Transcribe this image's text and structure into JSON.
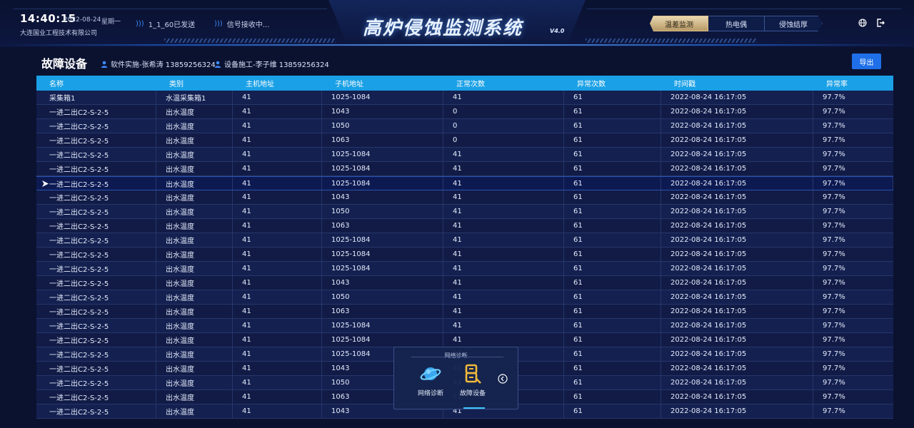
{
  "header": {
    "time": "14:40:15",
    "date": "2022-08-24",
    "weekday": "星期一",
    "company": "大连国业工程技术有限公司",
    "status_sent": "1_1_60已发送",
    "status_receiving": "信号接收中...",
    "title": "高炉侵蚀监测系统",
    "version": "V4.0",
    "tabs": [
      {
        "label": "温差监测",
        "active": true
      },
      {
        "label": "热电偶",
        "active": false
      },
      {
        "label": "侵蚀结厚",
        "active": false
      }
    ],
    "icons": {
      "language": "globe-icon",
      "logout": "exit-icon"
    }
  },
  "page": {
    "title": "故障设备",
    "contact_software": "软件实施-张希涛 13859256324",
    "contact_device": "设备施工-李子维 13859256324",
    "export_label": "导出"
  },
  "table": {
    "columns": [
      "名称",
      "类别",
      "主机地址",
      "子机地址",
      "正常次数",
      "异常次数",
      "时间戳",
      "异常率"
    ],
    "rows": [
      [
        "采集箱1",
        "水温采集箱1",
        "41",
        "1025-1084",
        "41",
        "61",
        "2022-08-24  16:17:05",
        "97.7%"
      ],
      [
        "一进二出C2-S-2-5",
        "出水温度",
        "41",
        "1043",
        "0",
        "61",
        "2022-08-24  16:17:05",
        "97.7%"
      ],
      [
        "一进二出C2-S-2-5",
        "出水温度",
        "41",
        "1050",
        "0",
        "61",
        "2022-08-24  16:17:05",
        "97.7%"
      ],
      [
        "一进二出C2-S-2-5",
        "出水温度",
        "41",
        "1063",
        "0",
        "61",
        "2022-08-24  16:17:05",
        "97.7%"
      ],
      [
        "一进二出C2-S-2-5",
        "出水温度",
        "41",
        "1025-1084",
        "41",
        "61",
        "2022-08-24  16:17:05",
        "97.7%"
      ],
      [
        "一进二出C2-S-2-5",
        "出水温度",
        "41",
        "1025-1084",
        "41",
        "61",
        "2022-08-24  16:17:05",
        "97.7%"
      ],
      [
        "一进二出C2-S-2-5",
        "出水温度",
        "41",
        "1025-1084",
        "41",
        "61",
        "2022-08-24  16:17:05",
        "97.7%"
      ],
      [
        "一进二出C2-S-2-5",
        "出水温度",
        "41",
        "1043",
        "41",
        "61",
        "2022-08-24  16:17:05",
        "97.7%"
      ],
      [
        "一进二出C2-S-2-5",
        "出水温度",
        "41",
        "1050",
        "41",
        "61",
        "2022-08-24  16:17:05",
        "97.7%"
      ],
      [
        "一进二出C2-S-2-5",
        "出水温度",
        "41",
        "1063",
        "41",
        "61",
        "2022-08-24  16:17:05",
        "97.7%"
      ],
      [
        "一进二出C2-S-2-5",
        "出水温度",
        "41",
        "1025-1084",
        "41",
        "61",
        "2022-08-24  16:17:05",
        "97.7%"
      ],
      [
        "一进二出C2-S-2-5",
        "出水温度",
        "41",
        "1025-1084",
        "41",
        "61",
        "2022-08-24  16:17:05",
        "97.7%"
      ],
      [
        "一进二出C2-S-2-5",
        "出水温度",
        "41",
        "1025-1084",
        "41",
        "61",
        "2022-08-24  16:17:05",
        "97.7%"
      ],
      [
        "一进二出C2-S-2-5",
        "出水温度",
        "41",
        "1043",
        "41",
        "61",
        "2022-08-24  16:17:05",
        "97.7%"
      ],
      [
        "一进二出C2-S-2-5",
        "出水温度",
        "41",
        "1050",
        "41",
        "61",
        "2022-08-24  16:17:05",
        "97.7%"
      ],
      [
        "一进二出C2-S-2-5",
        "出水温度",
        "41",
        "1063",
        "41",
        "61",
        "2022-08-24  16:17:05",
        "97.7%"
      ],
      [
        "一进二出C2-S-2-5",
        "出水温度",
        "41",
        "1025-1084",
        "41",
        "61",
        "2022-08-24  16:17:05",
        "97.7%"
      ],
      [
        "一进二出C2-S-2-5",
        "出水温度",
        "41",
        "1025-1084",
        "41",
        "61",
        "2022-08-24  16:17:05",
        "97.7%"
      ],
      [
        "一进二出C2-S-2-5",
        "出水温度",
        "41",
        "1025-1084",
        "41",
        "61",
        "2022-08-24  16:17:05",
        "97.7%"
      ],
      [
        "一进二出C2-S-2-5",
        "出水温度",
        "41",
        "1043",
        "41",
        "61",
        "2022-08-24  16:17:05",
        "97.7%"
      ],
      [
        "一进二出C2-S-2-5",
        "出水温度",
        "41",
        "1050",
        "41",
        "61",
        "2022-08-24  16:17:05",
        "97.7%"
      ],
      [
        "一进二出C2-S-2-5",
        "出水温度",
        "41",
        "1063",
        "41",
        "61",
        "2022-08-24  16:17:05",
        "97.7%"
      ],
      [
        "一进二出C2-S-2-5",
        "出水温度",
        "41",
        "1043",
        "41",
        "61",
        "2022-08-24  16:17:05",
        "97.7%"
      ]
    ],
    "selected_row": 6
  },
  "float_panel": {
    "title": "网络诊断",
    "items": [
      {
        "label": "网络诊断",
        "icon": "planet-icon"
      },
      {
        "label": "故障设备",
        "icon": "device-fault-icon"
      }
    ],
    "collapse_icon": "chevron-left-icon"
  },
  "colors": {
    "background": "#0b1230",
    "table_header": "#1aa0e6",
    "export_button": "#1f6fe8",
    "active_tab": "#d4b985"
  }
}
